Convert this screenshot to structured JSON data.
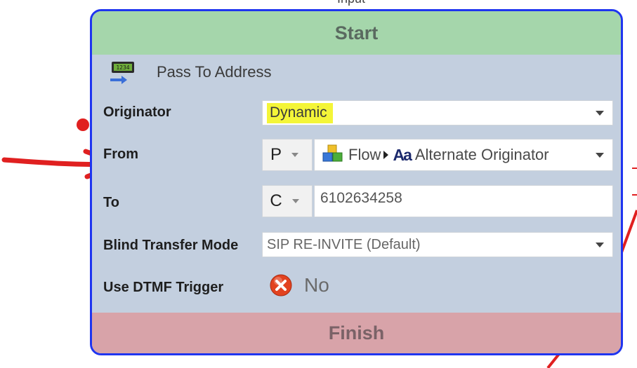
{
  "top_label": "Input",
  "start_label": "Start",
  "finish_label": "Finish",
  "header": {
    "title": "Pass To Address",
    "icon": "phone-display-icon"
  },
  "fields": {
    "originator": {
      "label": "Originator",
      "value": "Dynamic"
    },
    "from": {
      "label": "From",
      "prefix": "P",
      "source": "Flow",
      "value": "Alternate Originator"
    },
    "to": {
      "label": "To",
      "prefix": "C",
      "value": "6102634258"
    },
    "blind_transfer_mode": {
      "label": "Blind Transfer Mode",
      "value": "SIP RE-INVITE (Default)"
    },
    "use_dtmf_trigger": {
      "label": "Use DTMF Trigger",
      "value": "No"
    }
  },
  "colors": {
    "card_border": "#1f35f0",
    "start_bar": "#a5d6ab",
    "finish_bar": "#d8a3a9",
    "card_body": "#c3cfdf",
    "highlight": "#f4f538",
    "annotation": "#e02020"
  }
}
